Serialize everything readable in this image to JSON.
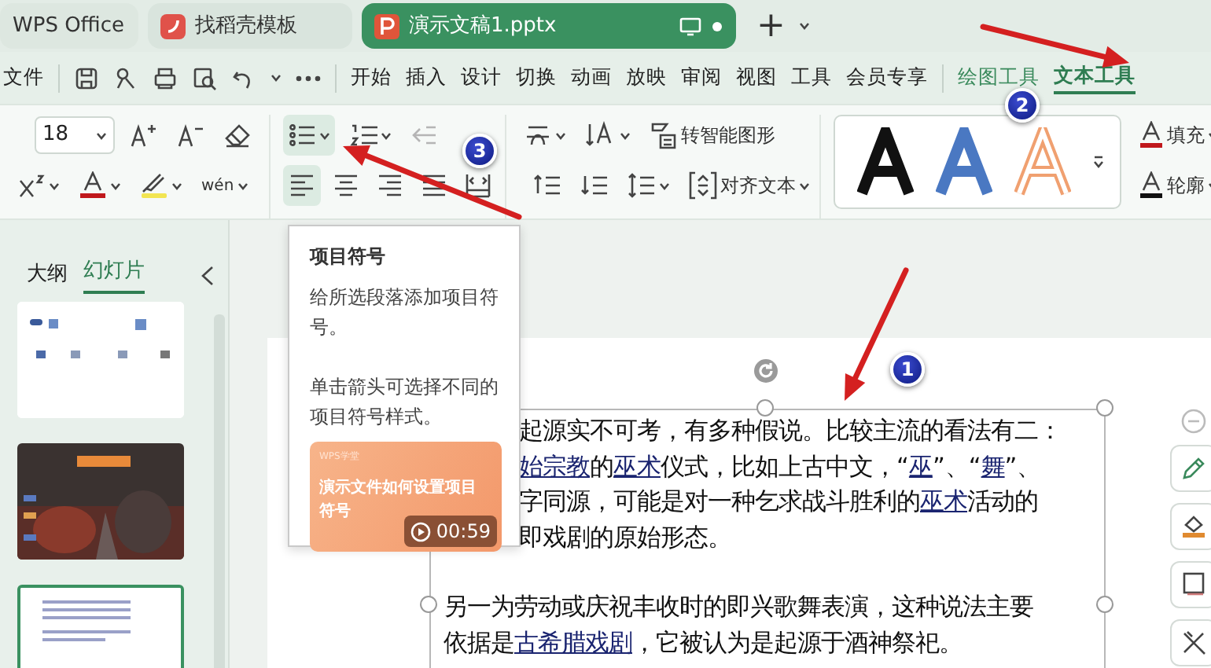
{
  "tabs": [
    {
      "kind": "home",
      "label": "WPS Office",
      "selected": false
    },
    {
      "kind": "docer",
      "label": "找稻壳模板",
      "selected": false
    },
    {
      "kind": "doc",
      "label": "演示文稿1.pptx",
      "selected": true
    }
  ],
  "new_tab": "+",
  "menu": {
    "file": "文件",
    "items": [
      {
        "label": "开始",
        "selected": false
      },
      {
        "label": "插入",
        "selected": false
      },
      {
        "label": "设计",
        "selected": false
      },
      {
        "label": "切换",
        "selected": false
      },
      {
        "label": "动画",
        "selected": false
      },
      {
        "label": "放映",
        "selected": false
      },
      {
        "label": "审阅",
        "selected": false
      },
      {
        "label": "视图",
        "selected": false
      },
      {
        "label": "工具",
        "selected": false
      },
      {
        "label": "会员专享",
        "selected": false
      }
    ],
    "context_items": [
      {
        "label": "绘图工具",
        "selected": false
      },
      {
        "label": "文本工具",
        "selected": true
      }
    ]
  },
  "ribbon": {
    "font_size": "18",
    "phonetic": "wén",
    "list_buttons": [
      {
        "kind": "bullets",
        "selected": true,
        "disabled": false
      },
      {
        "kind": "numbering",
        "selected": false,
        "disabled": false
      },
      {
        "kind": "outdent",
        "selected": false,
        "disabled": true
      }
    ],
    "align_buttons": [
      {
        "kind": "left",
        "selected": true
      },
      {
        "kind": "center",
        "selected": false
      },
      {
        "kind": "right",
        "selected": false
      },
      {
        "kind": "justify",
        "selected": false
      },
      {
        "kind": "distributed",
        "selected": false
      },
      {
        "kind": "spacing-up",
        "selected": false
      },
      {
        "kind": "spacing-down",
        "selected": false
      },
      {
        "kind": "line-spacing",
        "selected": false
      }
    ],
    "smart_art": "转智能图形",
    "align_text": "对齐文本",
    "styles": [
      {
        "color": "#111111"
      },
      {
        "color": "#4a78c2"
      },
      {
        "color": "#f0a070"
      }
    ],
    "fill": "填充",
    "outline": "轮廓"
  },
  "panel_tabs": [
    {
      "label": "大纲",
      "selected": false
    },
    {
      "label": "幻灯片",
      "selected": true
    }
  ],
  "slides": [
    {
      "kind": "toc",
      "selected": false
    },
    {
      "kind": "photo",
      "selected": false
    },
    {
      "kind": "text",
      "selected": true
    }
  ],
  "tooltip": {
    "title": "项目符号",
    "lines": [
      "给所选段落添加项目符号。",
      "单击箭头可选择不同的项目符号样式。"
    ],
    "video": {
      "brand": "WPS学堂",
      "title": "演示文件如何设置项目符号",
      "duration": "00:59"
    }
  },
  "slide_text": [
    {
      "lines": [
        [
          {
            "text": "起源实不可考，有多种假说。比较主流的看法有二："
          }
        ],
        [
          {
            "text": "始宗教",
            "link": true
          },
          {
            "text": "的"
          },
          {
            "text": "巫术",
            "link": true
          },
          {
            "text": "仪式，比如上古中文，“"
          },
          {
            "text": "巫",
            "link": true
          },
          {
            "text": "”、“"
          },
          {
            "text": "舞",
            "link": true
          },
          {
            "text": "”、"
          }
        ],
        [
          {
            "text": "字同源，可能是对一种乞求战斗胜利的"
          },
          {
            "text": "巫术",
            "link": true
          },
          {
            "text": "活动的"
          }
        ],
        [
          {
            "text": "即戏剧的原始形态。"
          }
        ]
      ]
    },
    {
      "lines": [
        [
          {
            "text": "另一为劳动或庆祝丰收时的即兴歌舞表演，这种说法主要"
          }
        ],
        [
          {
            "text": "依据是"
          },
          {
            "text": "古希腊戏剧",
            "link": true
          },
          {
            "text": "，它被认为是起源于酒神祭祀。"
          }
        ]
      ]
    }
  ],
  "annotations": [
    {
      "number": "1"
    },
    {
      "number": "2"
    },
    {
      "number": "3"
    }
  ]
}
